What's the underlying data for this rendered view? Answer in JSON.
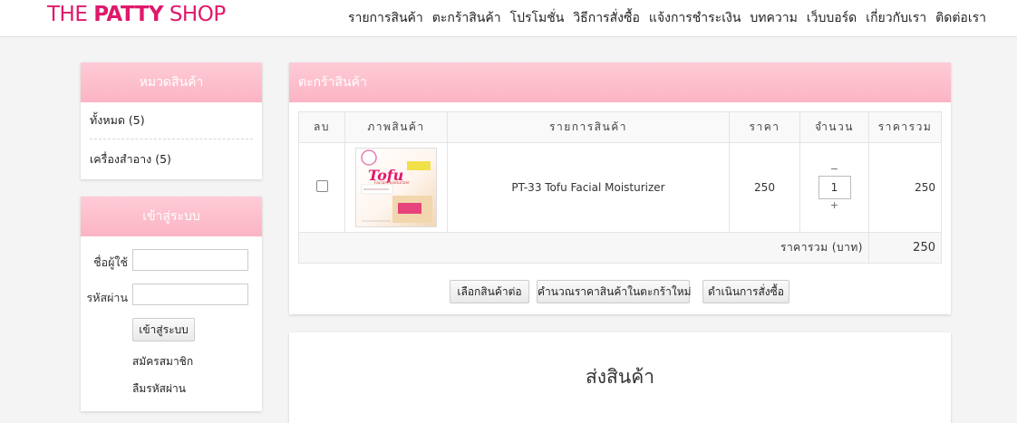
{
  "logo": {
    "part1": "THE ",
    "part2": "PATTY",
    "part3": " SHOP"
  },
  "nav": [
    "รายการสินค้า",
    "ตะกร้าสินค้า",
    "โปรโมชั่น",
    "วิธีการสั่งซื้อ",
    "แจ้งการชำระเงิน",
    "บทความ",
    "เว็บบอร์ด",
    "เกี่ยวกับเรา",
    "ติดต่อเรา"
  ],
  "categories": {
    "title": "หมวดสินค้า",
    "items": [
      "ทั้งหมด (5)",
      "เครื่องสำอาง (5)"
    ]
  },
  "login": {
    "title": "เข้าสู่ระบบ",
    "username_label": "ชื่อผู้ใช้",
    "password_label": "รหัสผ่าน",
    "username_value": "",
    "password_value": "",
    "submit_label": "เข้าสู่ระบบ",
    "register_link": "สมัครสมาชิก",
    "forgot_link": "ลืมรหัสผ่าน"
  },
  "cart": {
    "title": "ตะกร้าสินค้า",
    "columns": [
      "ลบ",
      "ภาพสินค้า",
      "รายการสินค้า",
      "ราคา",
      "จำนวน",
      "ราคารวม"
    ],
    "rows": [
      {
        "name": "PT-33 Tofu Facial Moisturizer",
        "price": "250",
        "qty": "1",
        "total": "250",
        "image_text": {
          "brand": "Tofu",
          "sub": "Facial Moisturizer"
        }
      }
    ],
    "qty_minus": "−",
    "qty_plus": "+",
    "sum_label": "ราคารวม (บาท)",
    "sum_value": "250",
    "buttons": {
      "continue": "เลือกสินค้าต่อ",
      "recalc": "คำนวณราคาสินค้าในตะกร้าใหม่",
      "checkout": "ดำเนินการสั่งซื้อ"
    }
  },
  "shipping": {
    "title": "ส่งสินค้า"
  },
  "colors": {
    "brand": "#e0196b",
    "panel_header": "#fbb4c4"
  }
}
